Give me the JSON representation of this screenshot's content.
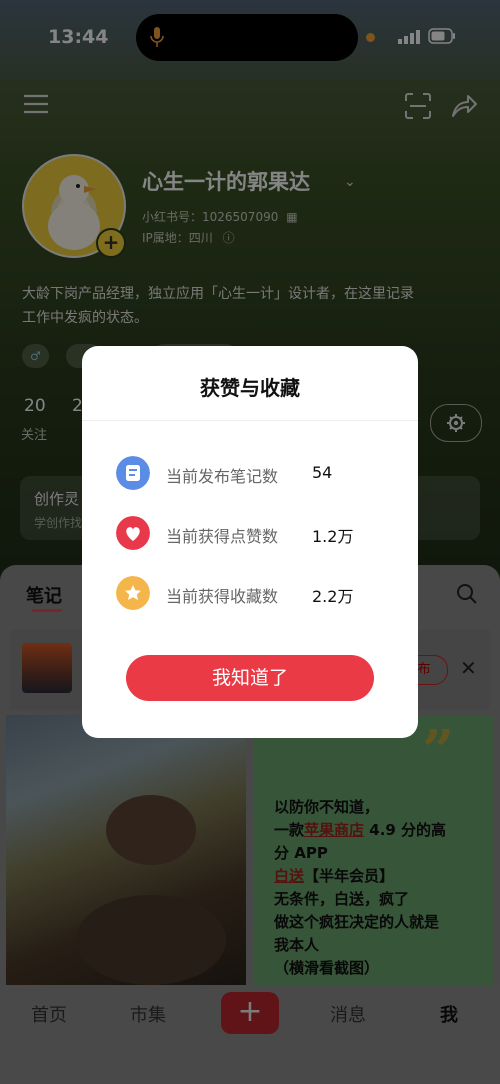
{
  "status_bar": {
    "time": "13:44"
  },
  "profile": {
    "name": "心生一计的郭果达",
    "xhs_id": "小红书号：1026507090",
    "ip": "IP属地：四川",
    "bio_line1": "大龄下岗产品经理，独立应用「心生一计」设计者，在这里记录",
    "bio_line2": "工作中发疯的状态。",
    "stats": [
      {
        "num": "20",
        "label": "关注"
      },
      {
        "num": "2",
        "label": ""
      }
    ],
    "creator_card": {
      "title": "创作灵",
      "sub": "学创作找"
    }
  },
  "tabs": {
    "notes": "笔记"
  },
  "draft": {
    "publish_label": "布"
  },
  "note_card": {
    "line1": "以防你不知道，",
    "line2a": "一款",
    "line2b": "苹果商店",
    "line2c": " 4.9 分的高",
    "line3": "分 APP",
    "line4a": "白送",
    "line4b": "【半年会员】",
    "line5": "无条件，白送，疯了",
    "line6": "做这个疯狂决定的人就是",
    "line7": "我本人",
    "line8": "（横滑看截图）"
  },
  "bottom_nav": {
    "home": "首页",
    "market": "市集",
    "add": "+",
    "messages": "消息",
    "me": "我"
  },
  "modal": {
    "title": "获赞与收藏",
    "rows": [
      {
        "label": "当前发布笔记数",
        "value": "54",
        "icon": "note-icon",
        "color": "#5b8de6"
      },
      {
        "label": "当前获得点赞数",
        "value": "1.2万",
        "icon": "heart-icon",
        "color": "#e8394a"
      },
      {
        "label": "当前获得收藏数",
        "value": "2.2万",
        "icon": "star-icon",
        "color": "#f4b54a"
      }
    ],
    "ok_label": "我知道了"
  }
}
